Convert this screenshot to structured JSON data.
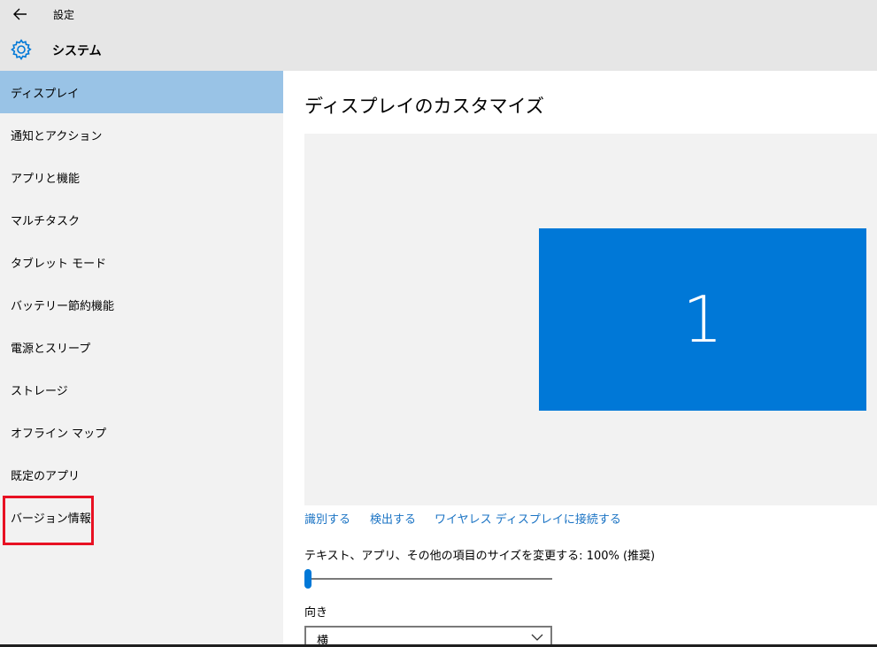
{
  "titlebar": {
    "app_title": "設定",
    "section_title": "システム",
    "back_icon": "back-arrow-icon",
    "section_icon": "gear-icon"
  },
  "sidebar": {
    "items": [
      {
        "label": "ディスプレイ",
        "active": true
      },
      {
        "label": "通知とアクション"
      },
      {
        "label": "アプリと機能"
      },
      {
        "label": "マルチタスク"
      },
      {
        "label": "タブレット モード"
      },
      {
        "label": "バッテリー節約機能"
      },
      {
        "label": "電源とスリープ"
      },
      {
        "label": "ストレージ"
      },
      {
        "label": "オフライン マップ"
      },
      {
        "label": "既定のアプリ"
      },
      {
        "label": "バージョン情報",
        "highlighted": true
      }
    ]
  },
  "main": {
    "page_title": "ディスプレイのカスタマイズ",
    "monitor_number": "1",
    "links": {
      "identify": "識別する",
      "detect": "検出する",
      "wireless": "ワイヤレス ディスプレイに接続する"
    },
    "scale_label": "テキスト、アプリ、その他の項目のサイズを変更する: 100% (推奨)",
    "scale_level": 0,
    "orientation_label": "向き",
    "orientation_value": "横"
  },
  "colors": {
    "accent": "#0078d7",
    "sidebar_active": "#99c3e6",
    "highlight_border": "#e81123",
    "link": "#1a73c4"
  }
}
